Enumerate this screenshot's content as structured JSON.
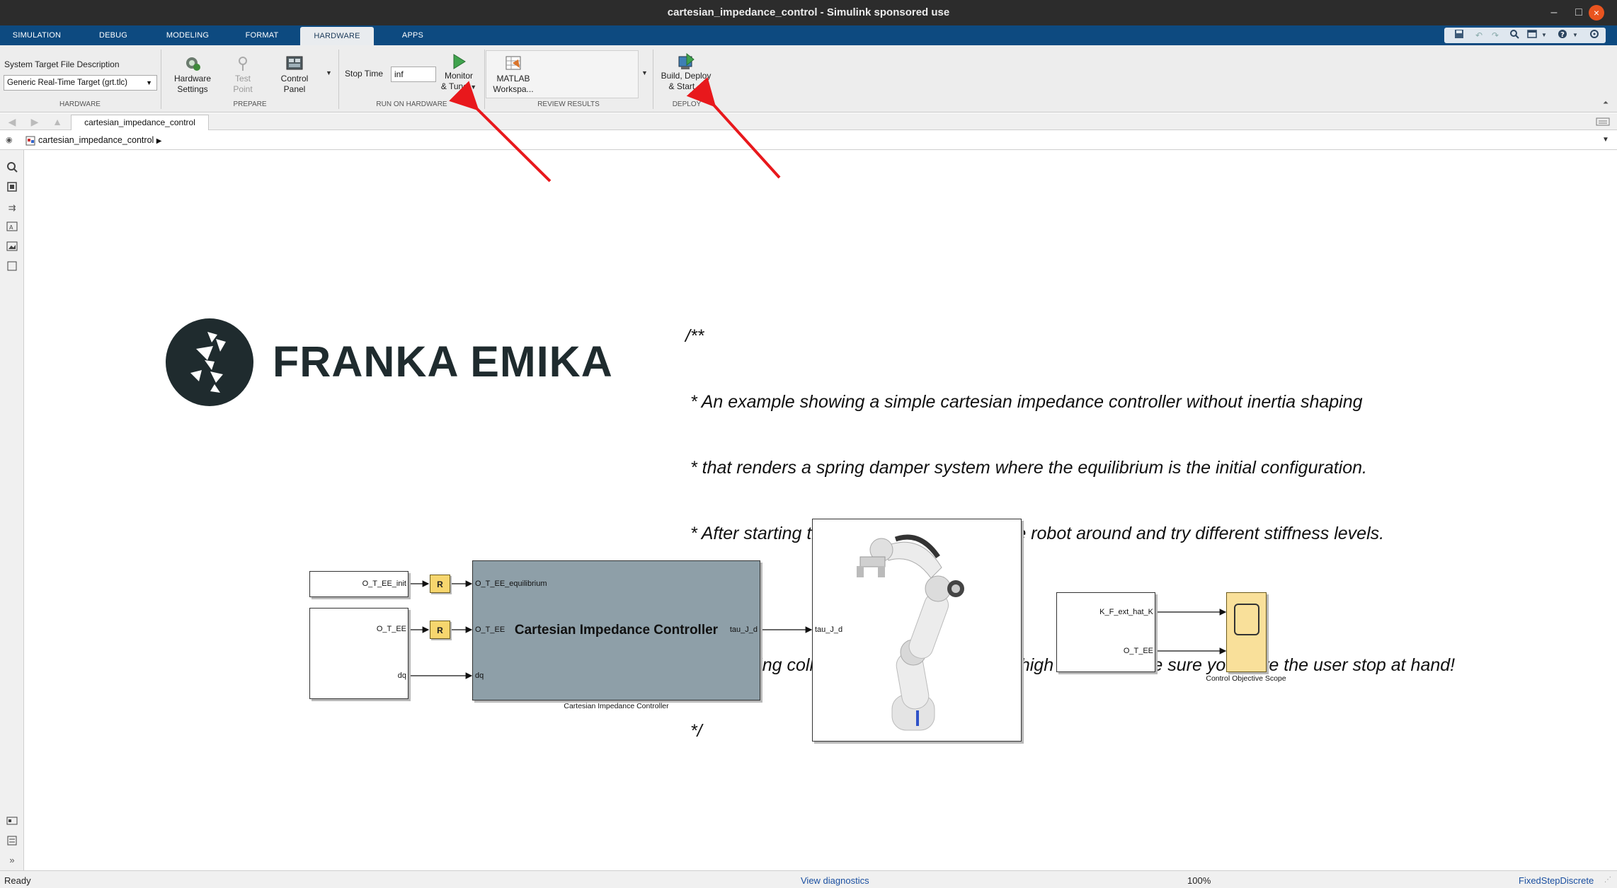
{
  "window": {
    "title": "cartesian_impedance_control - Simulink sponsored use",
    "controls": {
      "minimize": "–",
      "maximize": "□",
      "close": "×"
    }
  },
  "tabs": [
    {
      "label": "SIMULATION"
    },
    {
      "label": "DEBUG"
    },
    {
      "label": "MODELING"
    },
    {
      "label": "FORMAT"
    },
    {
      "label": "HARDWARE",
      "active": true
    },
    {
      "label": "APPS"
    }
  ],
  "ribbon": {
    "hardware": {
      "label": "HARDWARE",
      "stl_label": "System Target File Description",
      "stl_value": "Generic Real-Time Target (grt.tlc)"
    },
    "prepare": {
      "label": "PREPARE",
      "hardware_settings": "Hardware Settings",
      "hardware_settings_l1": "Hardware",
      "hardware_settings_l2": "Settings",
      "test_point_l1": "Test",
      "test_point_l2": "Point",
      "control_panel_l1": "Control",
      "control_panel_l2": "Panel"
    },
    "run": {
      "label": "RUN ON HARDWARE",
      "stop_time_label": "Stop Time",
      "stop_time_value": "inf",
      "monitor_l1": "Monitor",
      "monitor_l2": "& Tune"
    },
    "review": {
      "label": "REVIEW RESULTS",
      "matlab_l1": "MATLAB",
      "matlab_l2": "Workspa..."
    },
    "deploy": {
      "label": "DEPLOY",
      "build_l1": "Build, Deploy",
      "build_l2": "& Start"
    }
  },
  "explorer": {
    "model_tab": "cartesian_impedance_control",
    "breadcrumb": "cartesian_impedance_control"
  },
  "diagram": {
    "logo_text": "FRANKA EMIKA",
    "comment_lines": [
      "/**",
      " * An example showing a simple cartesian impedance controller without inertia shaping",
      " * that renders a spring damper system where the equilibrium is the initial configuration.",
      " * After starting the controller try to push the robot around and try different stiffness levels.",
      " *",
      " * @warning collision thresholds are set to high values. Make sure you have the user stop at hand!",
      " */"
    ],
    "block1_port": "O_T_EE_init",
    "block2_port1": "O_T_EE",
    "block2_port2": "dq",
    "rate_label": "R",
    "cic": {
      "title": "Cartesian Impedance Controller",
      "caption": "Cartesian Impedance Controller",
      "in1": "O_T_EE_equilibrium",
      "in2": "O_T_EE",
      "in3": "dq",
      "out1": "tau_J_d"
    },
    "robot_in": "tau_J_d",
    "block3_port1": "K_F_ext_hat_K",
    "block3_port2": "O_T_EE",
    "scope_caption": "Control Objective Scope"
  },
  "status": {
    "ready": "Ready",
    "diagnostics": "View diagnostics",
    "zoom": "100%",
    "solver": "FixedStepDiscrete"
  },
  "colors": {
    "titlebar": "#2c2c2c",
    "tabstrip": "#0d4a80",
    "controller_block": "#8e9fa8",
    "rate_block": "#f7d66e",
    "scope_block": "#f9e09a",
    "annotation_arrow": "#e8181c",
    "close_button": "#e9541f"
  }
}
